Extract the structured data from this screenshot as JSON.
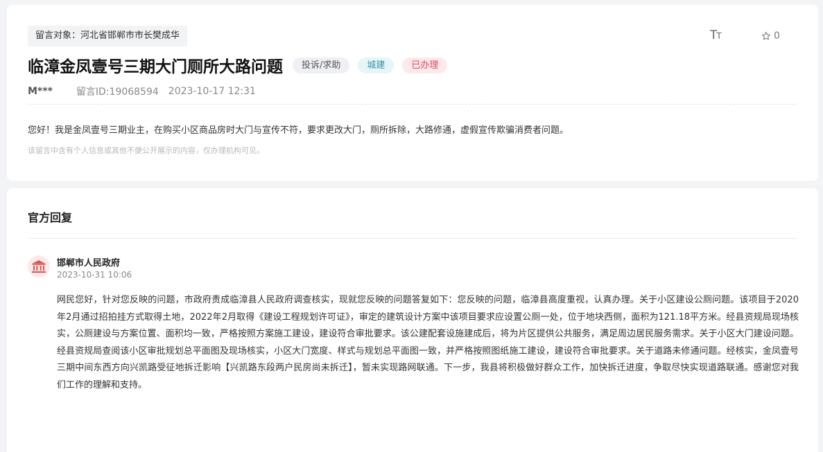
{
  "message": {
    "target": "留言对象：河北省邯郸市市长樊成华",
    "font_toggle": {
      "big": "T",
      "small": "T"
    },
    "star_count": "0",
    "title": "临漳金凤壹号三期大门厕所大路问题",
    "badges": {
      "type": "投诉/求助",
      "category": "城建",
      "status": "已办理"
    },
    "user": "M***",
    "id_label": "留言ID:19068594",
    "time": "2023-10-17 12:31",
    "content": "您好！我是金凤壹号三期业主，在购买小区商品房时大门与宣传不符，要求更改大门，厕所拆除，大路修通，虚假宣传欺骗消费者问题。",
    "privacy_note": "该留言中含有个人信息或其他不便公开展示的内容，仅办理机构可见。"
  },
  "reply": {
    "heading": "官方回复",
    "org_name": "邯郸市人民政府",
    "time": "2023-10-31 10:06",
    "body": "网民您好，针对您反映的问题，市政府责成临漳县人民政府调查核实，现就您反映的问题答复如下：您反映的问题，临漳县高度重视，认真办理。关于小区建设公厕问题。该项目于2020年2月通过招拍挂方式取得土地，2022年2月取得《建设工程规划许可证》，审定的建筑设计方案中该项目要求应设置公厕一处，位于地块西侧，面积为121.18平方米。经县资规局现场核实，公厕建设与方案位置、面积均一致，严格按照方案施工建设，建设符合审批要求。该公建配套设施建成后，将为片区提供公共服务，满足周边居民服务需求。关于小区大门建设问题。经县资规局查阅该小区审批规划总平面图及现场核实，小区大门宽度、样式与规划总平面图一致，并严格按照图纸施工建设，建设符合审批要求。关于道路未修通问题。经核实，金凤壹号三期中间东西方向兴凯路受征地拆迁影响【兴凯路东段两户民房尚未拆迁】，暂未实现路网联通。下一步，我县将积极做好群众工作，加快拆迁进度，争取尽快实现道路联通。感谢您对我们工作的理解和支持。"
  },
  "icons": {
    "font_size": "font-size-icon",
    "star": "star-icon",
    "org": "government-building-icon"
  },
  "colors": {
    "status_red": "#d94a5b",
    "category_teal": "#3a8fa8",
    "org_icon_red": "#d9534f"
  }
}
